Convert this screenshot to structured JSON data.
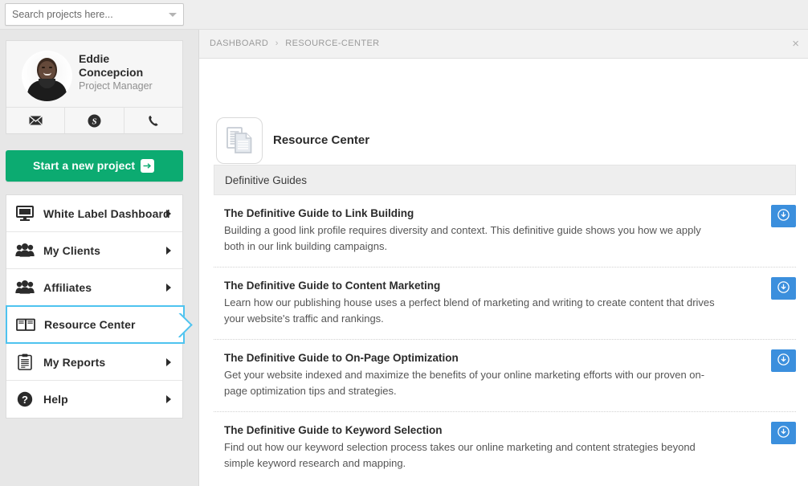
{
  "search": {
    "placeholder": "Search projects here...",
    "value": "",
    "caret_icon": "chevron-down-icon"
  },
  "profile": {
    "name": "Eddie Concepcion",
    "name_line1": "Eddie",
    "name_line2": "Concepcion",
    "role": "Project Manager",
    "contacts": [
      {
        "name": "email-icon",
        "label": "Email"
      },
      {
        "name": "skype-icon",
        "label": "Skype"
      },
      {
        "name": "phone-icon",
        "label": "Phone"
      }
    ]
  },
  "cta": {
    "label": "Start a new project",
    "arrow_icon": "arrow-right-icon",
    "color": "#0cab71"
  },
  "sidebar": {
    "items": [
      {
        "label": "White Label Dashboard",
        "icon": "monitor-icon",
        "has_chevron": true,
        "active": false
      },
      {
        "label": "My Clients",
        "icon": "users-icon",
        "has_chevron": true,
        "active": false
      },
      {
        "label": "Affiliates",
        "icon": "users-icon",
        "has_chevron": true,
        "active": false
      },
      {
        "label": "Resource Center",
        "icon": "book-icon",
        "has_chevron": false,
        "active": true
      },
      {
        "label": "My Reports",
        "icon": "clipboard-icon",
        "has_chevron": true,
        "active": false
      },
      {
        "label": "Help",
        "icon": "question-circle-icon",
        "has_chevron": true,
        "active": false
      }
    ],
    "active_color": "#4ec3ef"
  },
  "breadcrumb": {
    "items": [
      "DASHBOARD",
      "RESOURCE-CENTER"
    ],
    "separator": "›",
    "close_label": "×",
    "close_icon": "close-icon"
  },
  "page": {
    "title": "Resource Center",
    "icon": "documents-icon"
  },
  "guides": {
    "section_title": "Definitive Guides",
    "download_icon": "download-circle-icon",
    "download_color": "#3b8fdd",
    "items": [
      {
        "title": "The Definitive Guide to Link Building",
        "description": "Building a good link profile requires diversity and context. This definitive guide shows you how we apply both in our link building campaigns."
      },
      {
        "title": "The Definitive Guide to Content Marketing",
        "description": "Learn how our publishing house uses a perfect blend of marketing and writing to create content that drives your website's traffic and rankings."
      },
      {
        "title": "The Definitive Guide to On-Page Optimization",
        "description": "Get your website indexed and maximize the benefits of your online marketing efforts with our proven on-page optimization tips and strategies."
      },
      {
        "title": "The Definitive Guide to Keyword Selection",
        "description": "Find out how our keyword selection process takes our online marketing and content strategies beyond simple keyword research and mapping."
      }
    ]
  }
}
